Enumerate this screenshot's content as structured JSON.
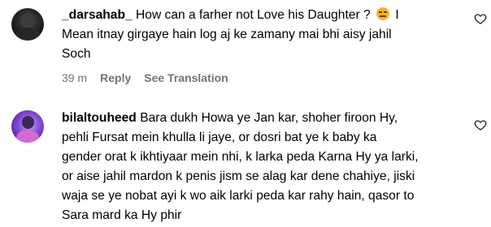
{
  "comments": [
    {
      "username": "_darsahab_",
      "lines": [
        "How can a farher not Love his Daughter ?",
        "Mean itnay girgaye hain log aj ke zamany mai bhi aisy jahil",
        "Soch"
      ],
      "first_line_suffix": "I",
      "emoji": "unamused-face-emoji",
      "time": "39 m",
      "reply_label": "Reply",
      "translate_label": "See Translation"
    },
    {
      "username": "bilaltouheed",
      "lines": [
        "Bara dukh Howa ye Jan kar, shoher firoon Hy,",
        "pehli Fursat mein khulla li jaye, or dosri bat ye k baby ka",
        "gender orat k ikhtiyaar mein nhi, k larka peda Karna Hy ya larki,",
        "or aise jahil mardon k penis jism se alag kar dene chahiye, jiski",
        "waja se ye nobat ayi k wo aik larki peda kar rahy hain, qasor to",
        "Sara mard ka Hy phir"
      ]
    }
  ],
  "icons": {
    "like": "heart-outline-icon"
  }
}
